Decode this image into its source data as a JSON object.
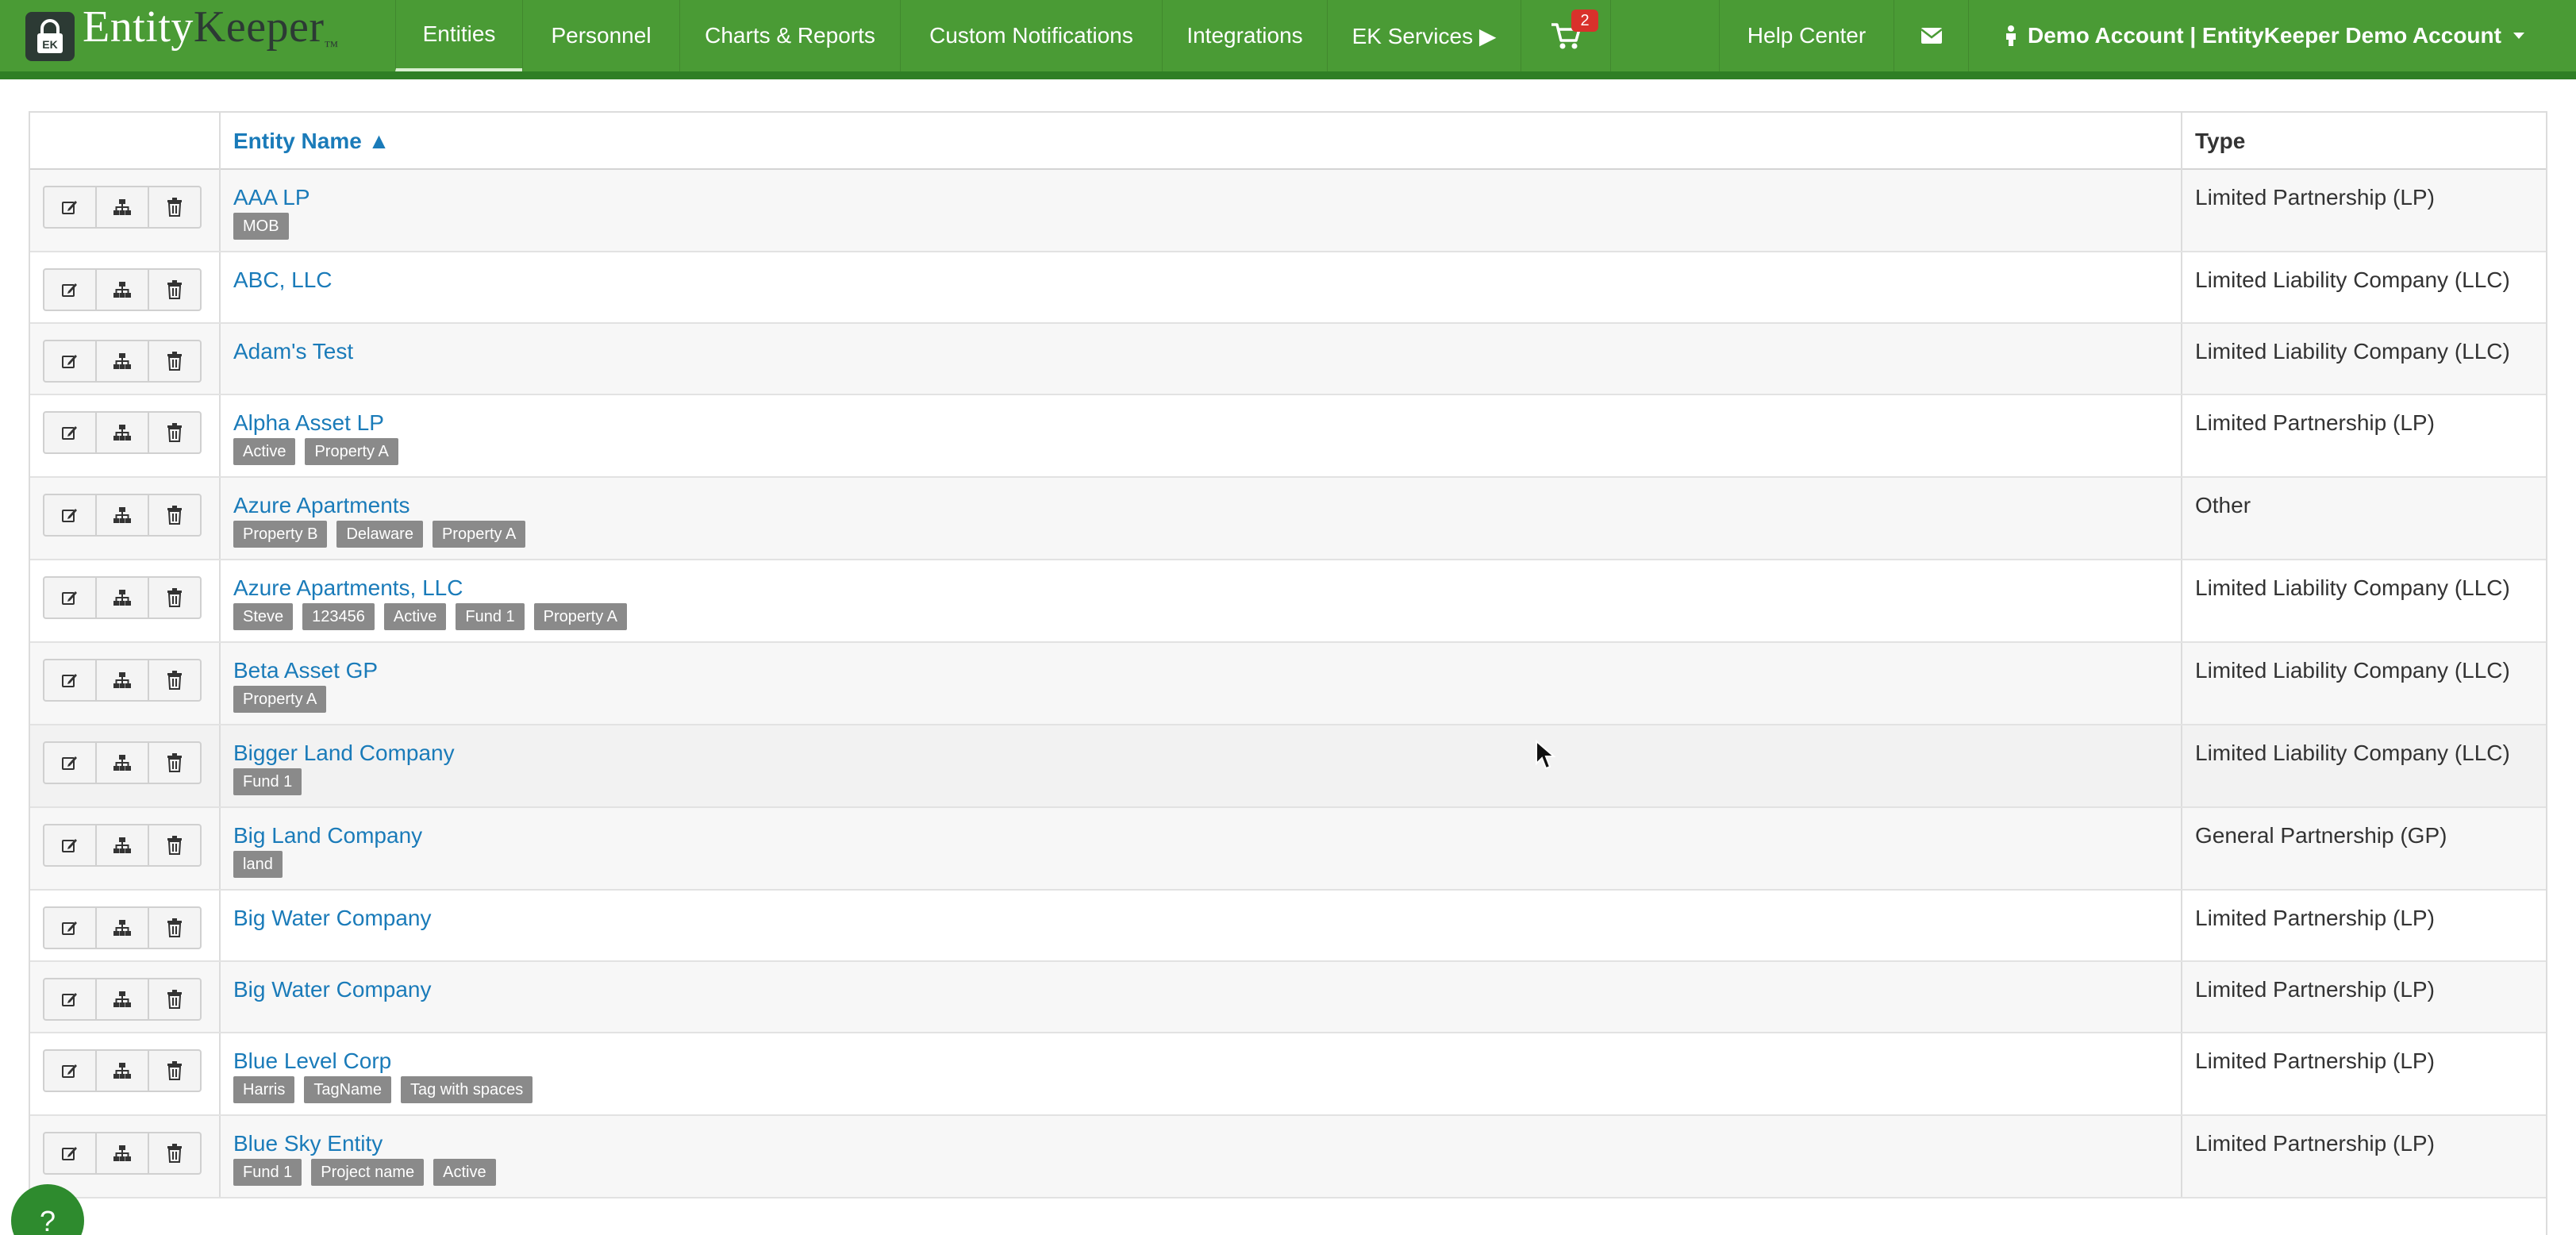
{
  "brand": {
    "part1": "Entity",
    "part2": "Keeper",
    "tm": "™",
    "lock_glyph": "EK"
  },
  "nav": {
    "items": [
      {
        "label": "Entities",
        "active": true
      },
      {
        "label": "Personnel"
      },
      {
        "label": "Charts & Reports"
      },
      {
        "label": "Custom Notifications"
      },
      {
        "label": "Integrations"
      },
      {
        "label": "EK Services ▶"
      }
    ],
    "cart_badge": "2",
    "help_center": "Help Center",
    "account": "Demo Account | EntityKeeper Demo Account"
  },
  "table": {
    "col_name": "Entity Name ▲",
    "col_type": "Type",
    "rows": [
      {
        "name": "AAA LP",
        "tags": [
          "MOB"
        ],
        "type": "Limited Partnership (LP)"
      },
      {
        "name": "ABC, LLC",
        "tags": [],
        "type": "Limited Liability Company (LLC)"
      },
      {
        "name": "Adam's Test",
        "tags": [],
        "type": "Limited Liability Company (LLC)"
      },
      {
        "name": "Alpha Asset LP",
        "tags": [
          "Active",
          "Property A"
        ],
        "type": "Limited Partnership (LP)"
      },
      {
        "name": "Azure Apartments",
        "tags": [
          "Property B",
          "Delaware",
          "Property A"
        ],
        "type": "Other"
      },
      {
        "name": "Azure Apartments, LLC",
        "tags": [
          "Steve",
          "123456",
          "Active",
          "Fund 1",
          "Property A"
        ],
        "type": "Limited Liability Company (LLC)"
      },
      {
        "name": "Beta Asset GP",
        "tags": [
          "Property A"
        ],
        "type": "Limited Liability Company (LLC)"
      },
      {
        "name": "Bigger Land Company",
        "tags": [
          "Fund 1"
        ],
        "type": "Limited Liability Company (LLC)"
      },
      {
        "name": "Big Land Company",
        "tags": [
          "land"
        ],
        "type": "General Partnership (GP)"
      },
      {
        "name": "Big Water Company",
        "tags": [],
        "type": "Limited Partnership (LP)"
      },
      {
        "name": "Big Water Company",
        "tags": [],
        "type": "Limited Partnership (LP)"
      },
      {
        "name": "Blue Level Corp",
        "tags": [
          "Harris",
          "TagName",
          "Tag with spaces"
        ],
        "type": "Limited Partnership (LP)"
      },
      {
        "name": "Blue Sky Entity",
        "tags": [
          "Fund 1",
          "Project name",
          "Active"
        ],
        "type": "Limited Partnership (LP)"
      }
    ]
  },
  "help_button": "?",
  "colors": {
    "nav_green": "#4a9b35",
    "link_blue": "#1a7bb9",
    "tag_gray": "#8a8a8a",
    "badge_red": "#d9312b"
  }
}
